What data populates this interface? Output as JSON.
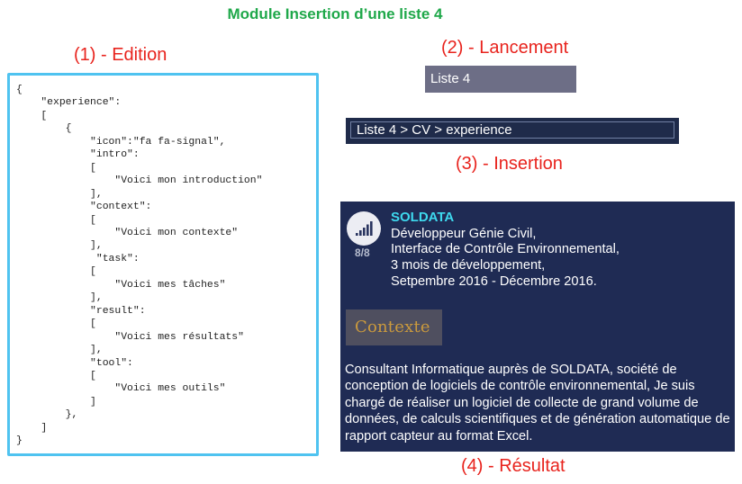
{
  "title": "Module Insertion d’une liste 4",
  "steps": {
    "edition": "(1) - Edition",
    "launch": "(2) - Lancement",
    "insertion": "(3) - Insertion",
    "result": "(4) - Résultat"
  },
  "editor": {
    "code": "{\n    \"experience\":\n    [\n        {\n            \"icon\":\"fa fa-signal\",\n            \"intro\":\n            [\n                \"Voici mon introduction\"\n            ],\n            \"context\":\n            [\n                \"Voici mon contexte\"\n            ],\n             \"task\":\n            [\n                \"Voici mes tâches\"\n            ],\n            \"result\":\n            [\n                \"Voici mes résultats\"\n            ],\n            \"tool\":\n            [\n                \"Voici mes outils\"\n            ]\n        },\n    ]\n}"
  },
  "launch": {
    "label": "Liste 4"
  },
  "insertion": {
    "path": "Liste 4 > CV > experience"
  },
  "result": {
    "icon": "signal-icon",
    "score": "8/8",
    "company": "SOLDATA",
    "details": [
      "Développeur Génie Civil,",
      "Interface de Contrôle Environnemental,",
      "3 mois de développement,",
      "Setpembre 2016 - Décembre 2016."
    ],
    "context_label": "Contexte",
    "context_text": "Consultant Informatique auprès de SOLDATA, société de conception de logiciels de contrôle environnemental, Je suis chargé de réaliser un logiciel de collecte de grand volume de données, de calculs scientifiques et de génération automatique de rapport capteur au format Excel."
  },
  "colors": {
    "title": "#1fa84a",
    "labels": "#e8231d",
    "editor_border": "#4fc3f0",
    "card_bg": "#1f2b54",
    "company": "#3ed9ee",
    "context_badge_text": "#cb9a3d"
  }
}
